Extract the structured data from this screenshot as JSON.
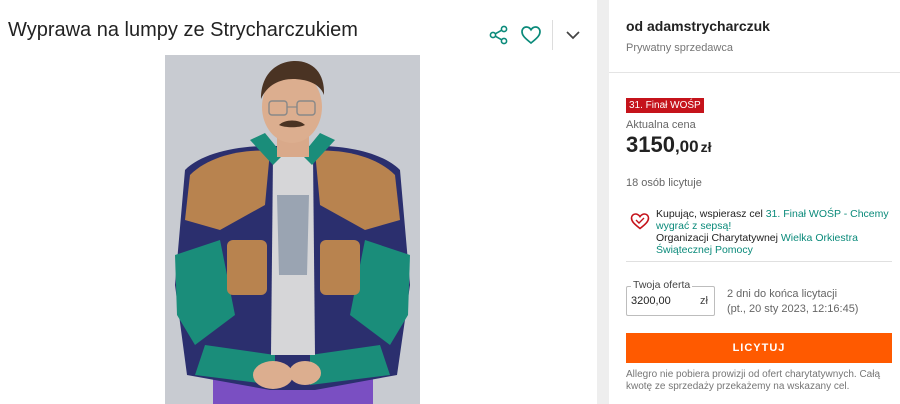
{
  "listing": {
    "title": "Wyprawa na lumpy ze Strycharczukiem",
    "photo_alt": "Man in retro jacket"
  },
  "icons": {
    "share": "share-icon",
    "favorite": "heart-icon",
    "more": "chevron-down-icon",
    "charity": "charity-heart-icon"
  },
  "seller": {
    "name": "od adamstrycharczuk",
    "type": "Prywatny sprzedawca"
  },
  "auction": {
    "badge": "31. Finał WOŚP",
    "price_label": "Aktualna cena",
    "price_main": "3150",
    "price_decimal": ",00",
    "price_currency": "zł",
    "bidders": "18 osób licytuje"
  },
  "charity": {
    "text_before": "Kupując, wspierasz cel ",
    "goal_link": "31. Finał WOŚP - Chcemy wygrać z sepsą!",
    "org_prefix": "Organizacji Charytatywnej ",
    "org_link": "Wielka Orkiestra Świątecznej Pomocy"
  },
  "offer": {
    "label": "Twoja oferta",
    "value": "3200,00",
    "currency": "zł",
    "time_left": "2 dni do końca licytacji",
    "end_date": "(pt., 20 sty 2023, 12:16:45)"
  },
  "bid_button": "LICYTUJ",
  "note": "Allegro nie pobiera prowizji od ofert charytatywnych. Całą kwotę ze sprzedaży przekażemy na wskazany cel.",
  "colors": {
    "accent_teal": "#0a8a7a",
    "button_orange": "#ff5a00",
    "badge_red": "#c5131b"
  }
}
